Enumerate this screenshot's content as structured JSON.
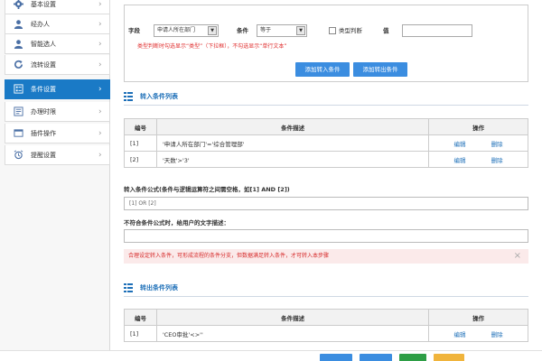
{
  "sidebar": {
    "items": [
      {
        "label": "基本设置",
        "icon": "gear-icon"
      },
      {
        "label": "经办人",
        "icon": "user-icon"
      },
      {
        "label": "智能选人",
        "icon": "user-icon"
      },
      {
        "label": "流转设置",
        "icon": "refresh-icon"
      },
      {
        "label": "条件设置",
        "icon": "condition-icon"
      },
      {
        "label": "办理时限",
        "icon": "list-icon"
      },
      {
        "label": "插件操作",
        "icon": "window-icon"
      },
      {
        "label": "提醒设置",
        "icon": "alarm-icon"
      }
    ]
  },
  "condition_form": {
    "field_label": "字段",
    "field_value": "申请人所在部门",
    "condition_label": "条件",
    "condition_value": "等于",
    "type_check_label": "类型判断",
    "value_label": "值",
    "hint": "类型判断时勾选显示“类型”（下拉框），不勾选显示“单行文本”",
    "add_in_button": "添加转入条件",
    "add_out_button": "添加转出条件"
  },
  "in_section": {
    "title": "转入条件列表",
    "headers": [
      "编号",
      "条件描述",
      "操作"
    ],
    "rows": [
      {
        "id": "[1]",
        "desc": "'申请人所在部门'='综合管理部'",
        "edit": "编辑",
        "delete": "删除"
      },
      {
        "id": "[2]",
        "desc": "'天数'>'3'",
        "edit": "编辑",
        "delete": "删除"
      }
    ]
  },
  "formula": {
    "label": "转入条件公式(条件与逻辑运算符之间需空格，如[1] AND [2])",
    "value": "[1] OR [2]",
    "fail_label": "不符合条件公式时，给用户的文字描述：",
    "fail_value": ""
  },
  "alert": {
    "text": "合理设定转入条件，可形成流程的条件分支，但数据满足转入条件，才可转入本步骤",
    "close": "×"
  },
  "out_section": {
    "title": "转出条件列表",
    "headers": [
      "编号",
      "条件描述",
      "操作"
    ],
    "rows": [
      {
        "id": "[1]",
        "desc": "'CEO审批'<>''",
        "edit": "编辑",
        "delete": "删除"
      }
    ]
  },
  "colors": {
    "accent": "#1a7ac6",
    "button": "#3b8de0",
    "alert_bg": "#fbeaea",
    "alert_text": "#d62b2b"
  }
}
